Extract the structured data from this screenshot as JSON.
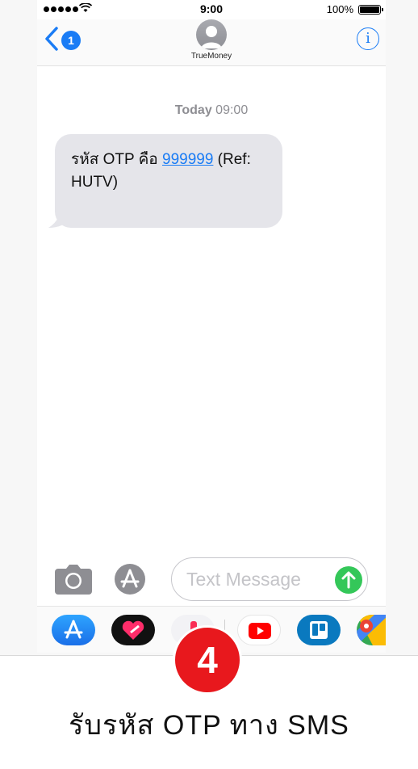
{
  "status_bar": {
    "time": "9:00",
    "battery": "100%"
  },
  "header": {
    "back_badge": "1",
    "contact_name": "TrueMoney",
    "info_label": "i"
  },
  "conversation": {
    "timestamp_day": "Today",
    "timestamp_time": "09:00",
    "message_prefix": "รหัส OTP คือ ",
    "otp_code": "999999",
    "message_suffix": " (Ref: HUTV)"
  },
  "composer": {
    "placeholder": "Text Message"
  },
  "app_drawer": {
    "apps": [
      "app-store-icon",
      "love-app-icon",
      "music-app-icon",
      "youtube-icon",
      "trello-icon",
      "google-maps-icon"
    ]
  },
  "step": {
    "number": "4",
    "caption": "รับรหัส OTP ทาง SMS"
  },
  "colors": {
    "accent": "#1a7cf5",
    "bubble": "#e5e5ea",
    "send": "#34c759",
    "step_badge": "#e8181d"
  }
}
